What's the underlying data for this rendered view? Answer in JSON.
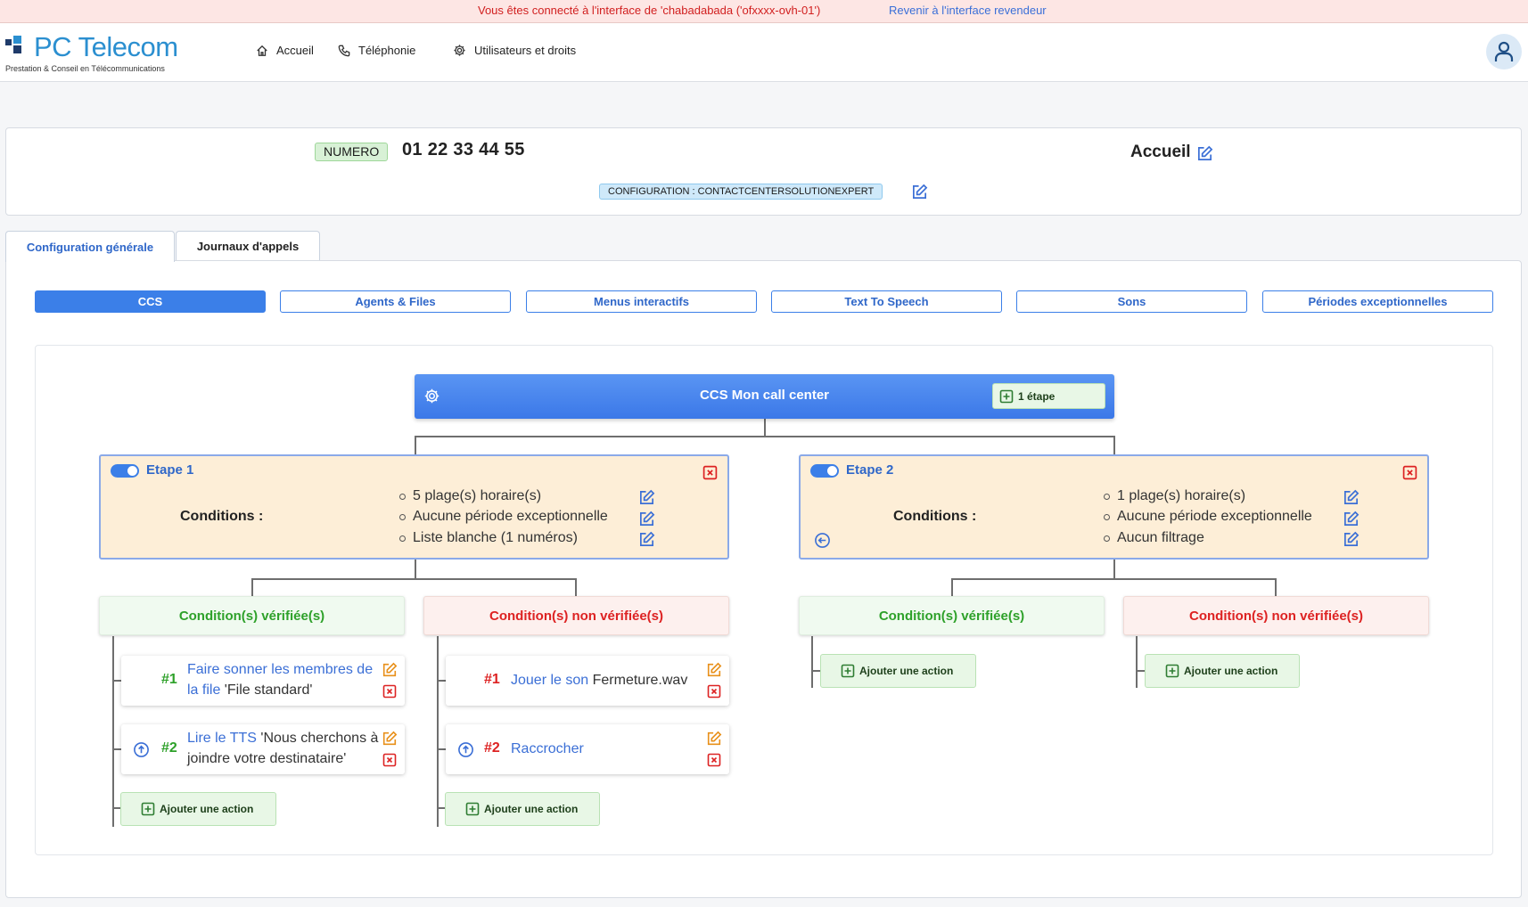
{
  "banner": {
    "message": "Vous êtes connecté à l'interface de 'chabadabada ('ofxxxx-ovh-01')",
    "back_link": "Revenir à l'interface revendeur"
  },
  "brand": {
    "name": "PC Telecom",
    "tagline": "Prestation & Conseil en Télécommunications",
    "color": "#2b8fd0"
  },
  "nav": {
    "home": "Accueil",
    "telephony": "Téléphonie",
    "users": "Utilisateurs et droits"
  },
  "header": {
    "numero_badge": "NUMERO",
    "phone": "01 22 33 44 55",
    "title": "Accueil",
    "config_badge": "CONFIGURATION : CONTACTCENTERSOLUTIONEXPERT"
  },
  "tabs": [
    {
      "label": "Configuration générale",
      "active": true
    },
    {
      "label": "Journaux d'appels",
      "active": false
    }
  ],
  "subtabs": [
    {
      "label": "CCS",
      "active": true
    },
    {
      "label": "Agents & Files"
    },
    {
      "label": "Menus interactifs"
    },
    {
      "label": "Text To Speech"
    },
    {
      "label": "Sons"
    },
    {
      "label": "Périodes exceptionnelles"
    }
  ],
  "ccs": {
    "title": "CCS Mon call center",
    "add_step": "1 étape"
  },
  "steps": [
    {
      "label": "Etape 1",
      "conditions_label": "Conditions :",
      "conditions": [
        "5 plage(s) horaire(s)",
        "Aucune période exceptionnelle",
        "Liste blanche (1 numéros)"
      ],
      "ok_label": "Condition(s) vérifiée(s)",
      "ko_label": "Condition(s) non vérifiée(s)",
      "ok_actions": [
        {
          "num": "#1",
          "link": "Faire sonner les membres de la file",
          "link1": "Faire sonner les membres de",
          "link2": "la file",
          "rest": " 'File standard'"
        },
        {
          "num": "#2",
          "link": "Lire le TTS",
          "rest1": " 'Nous cherchons à",
          "rest2": "joindre votre destinataire'"
        }
      ],
      "ko_actions": [
        {
          "num": "#1",
          "link": "Jouer le son",
          "rest": " Fermeture.wav"
        },
        {
          "num": "#2",
          "link": "Raccrocher"
        }
      ],
      "add_action": "Ajouter une action"
    },
    {
      "label": "Etape 2",
      "conditions_label": "Conditions :",
      "conditions": [
        "1 plage(s) horaire(s)",
        "Aucune période exceptionnelle",
        "Aucun filtrage"
      ],
      "ok_label": "Condition(s) vérifiée(s)",
      "ko_label": "Condition(s) non vérifiée(s)",
      "add_action": "Ajouter une action"
    }
  ],
  "colors": {
    "primary": "#3b7fe8",
    "success": "#2ea12a",
    "danger": "#dd2222",
    "warning": "#e8901a",
    "step_bg": "#fdeed7"
  }
}
